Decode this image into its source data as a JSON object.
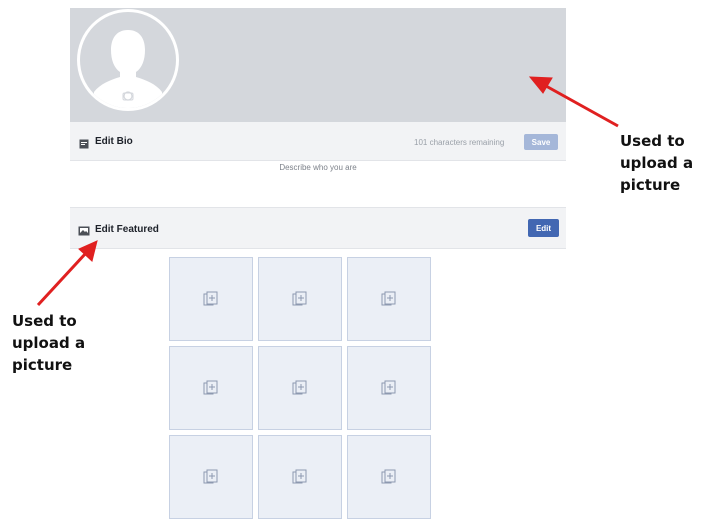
{
  "profile": {
    "bio": {
      "edit_label": "Edit Bio",
      "chars_remaining": "101 characters remaining",
      "save_label": "Save",
      "placeholder": "Describe who you are"
    },
    "featured": {
      "edit_label": "Edit Featured",
      "edit_button": "Edit",
      "tiles": [
        {
          "icon": "add-photo-icon"
        },
        {
          "icon": "add-photo-icon"
        },
        {
          "icon": "add-photo-icon"
        },
        {
          "icon": "add-photo-icon"
        },
        {
          "icon": "add-photo-icon"
        },
        {
          "icon": "add-photo-icon"
        },
        {
          "icon": "add-photo-icon"
        },
        {
          "icon": "add-photo-icon"
        },
        {
          "icon": "add-photo-icon"
        }
      ]
    }
  },
  "annotations": {
    "right_note": "Used to\nupload a\npicture",
    "left_note": "Used to\nupload a\npicture",
    "arrow_color": "#e02020"
  },
  "colors": {
    "cover": "#d4d7dc",
    "save_button_disabled": "#a5b7d9",
    "edit_button": "#4267b2",
    "tile_background": "#ebeff6"
  }
}
